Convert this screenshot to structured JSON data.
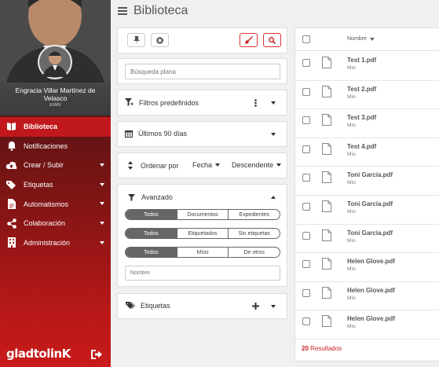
{
  "header": {
    "title": "Biblioteca"
  },
  "user": {
    "name": "Engracia Villar Martínez de Velasco",
    "tag": "EVMV"
  },
  "nav": [
    {
      "label": "Biblioteca",
      "icon": "library-icon",
      "active": true,
      "caret": false
    },
    {
      "label": "Notificaciones",
      "icon": "bell-icon",
      "active": false,
      "caret": false
    },
    {
      "label": "Crear / Subir",
      "icon": "cloud-upload-icon",
      "active": false,
      "caret": true
    },
    {
      "label": "Etiquetas",
      "icon": "tags-icon",
      "active": false,
      "caret": true
    },
    {
      "label": "Automatismos",
      "icon": "document-icon",
      "active": false,
      "caret": true
    },
    {
      "label": "Colaboración",
      "icon": "share-icon",
      "active": false,
      "caret": true
    },
    {
      "label": "Administración",
      "icon": "building-icon",
      "active": false,
      "caret": true
    }
  ],
  "logo": "gladtolinK",
  "search": {
    "placeholder": "Búsqueda plana"
  },
  "filters": {
    "predefined_label": "Filtros predefinidos",
    "date_label": "Últimos 90 días",
    "sort_prefix": "Ordenar por",
    "sort_field": "Fecha",
    "sort_dir": "Descendente",
    "advanced_label": "Avanzado",
    "seg1": [
      "Todos",
      "Documentos",
      "Expedientes"
    ],
    "seg2": [
      "Todos",
      "Etiquetados",
      "Sin etiquetas"
    ],
    "seg3": [
      "Todos",
      "Míos",
      "De otros"
    ],
    "name_placeholder": "Nombre",
    "tags_label": "Etiquetas"
  },
  "results": {
    "column": "Nombre",
    "count_num": "20",
    "count_label": "Resultados",
    "files": [
      {
        "name": "Test 1.pdf",
        "owner": "Mío"
      },
      {
        "name": "Test 2.pdf",
        "owner": "Mío"
      },
      {
        "name": "Test 3.pdf",
        "owner": "Mío"
      },
      {
        "name": "Test 4.pdf",
        "owner": "Mío"
      },
      {
        "name": "Toni García.pdf",
        "owner": "Mío"
      },
      {
        "name": "Toni García.pdf",
        "owner": "Mío"
      },
      {
        "name": "Toni García.pdf",
        "owner": "Mío"
      },
      {
        "name": "Helen Glove.pdf",
        "owner": "Mío"
      },
      {
        "name": "Helen Glove.pdf",
        "owner": "Mío"
      },
      {
        "name": "Helen Glove.pdf",
        "owner": "Mío"
      }
    ]
  },
  "colors": {
    "accent": "#c92020",
    "sidebar_dark": "#3a1010",
    "sidebar_red": "#c91a1a"
  }
}
